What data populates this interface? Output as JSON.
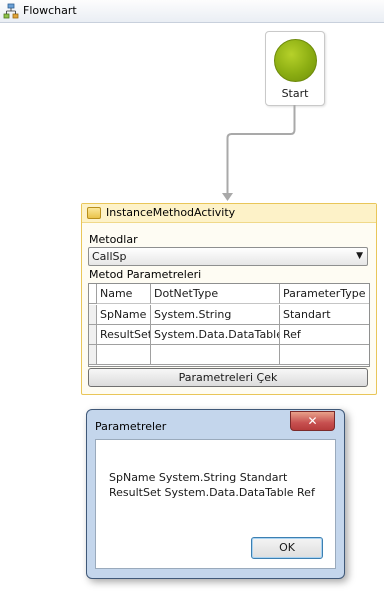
{
  "header": {
    "title": "Flowchart",
    "icon": "flowchart-icon"
  },
  "start_node": {
    "label": "Start"
  },
  "activity": {
    "title": "InstanceMethodActivity",
    "methods_label": "Metodlar",
    "method_selected": "CallSp",
    "params_label": "Metod Parametreleri",
    "columns": [
      "Name",
      "DotNetType",
      "ParameterType"
    ],
    "rows": [
      [
        "SpName",
        "System.String",
        "Standart"
      ],
      [
        "ResultSet",
        "System.Data.DataTable",
        "Ref"
      ],
      [
        "",
        "",
        ""
      ]
    ],
    "button_label": "Parametreleri Çek"
  },
  "dialog": {
    "title": "Parametreler",
    "close_label": "✕",
    "lines": [
      "SpName System.String Standart",
      "ResultSet System.Data.DataTable Ref"
    ],
    "ok_label": "OK"
  }
}
